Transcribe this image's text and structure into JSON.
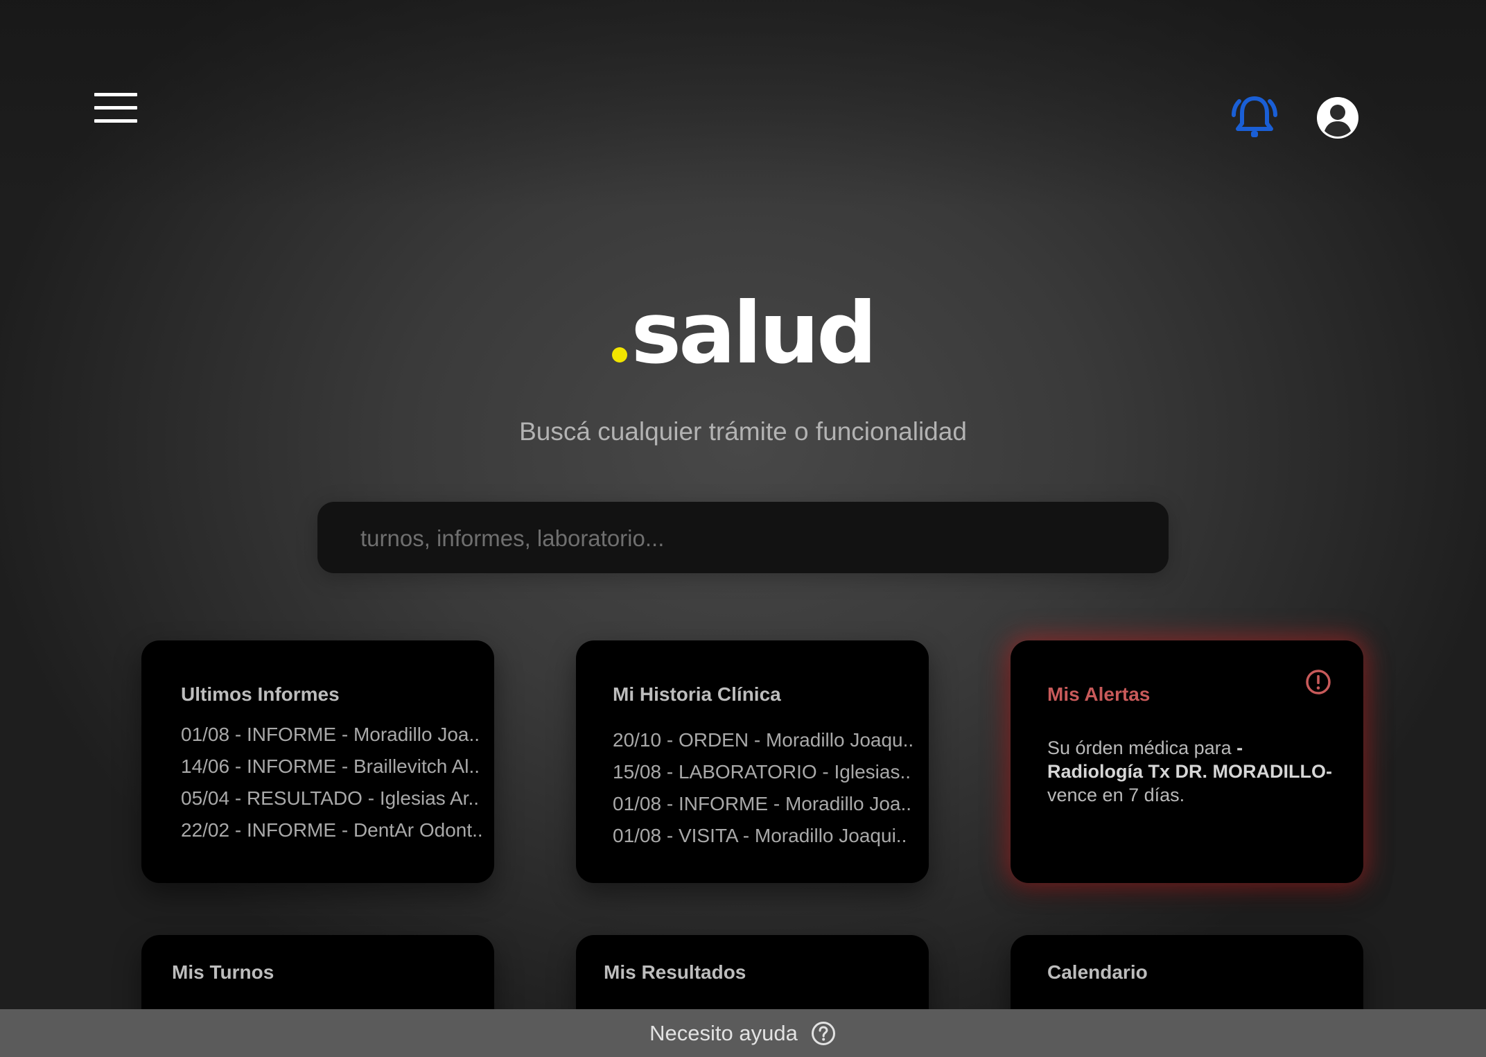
{
  "header": {
    "menu_icon": "hamburger-menu-icon",
    "notifications_icon": "bell-ringing-icon",
    "notifications_color": "#1a5fd6",
    "profile_icon": "user-circle-icon"
  },
  "brand": {
    "dot": ".",
    "name": "salud",
    "dot_color": "#f2e500"
  },
  "hero": {
    "subtitle": "Buscá cualquier trámite o funcionalidad"
  },
  "search": {
    "placeholder": "turnos, informes, laboratorio...",
    "value": ""
  },
  "cards": {
    "informes": {
      "title": "Ultimos Informes",
      "items": [
        "01/08 - INFORME - Moradillo Joa..",
        "14/06 - INFORME - Braillevitch Al..",
        "05/04 - RESULTADO - Iglesias Ar..",
        "22/02 - INFORME - DentAr Odont.."
      ]
    },
    "historia": {
      "title": "Mi Historia Clínica",
      "items": [
        "20/10 - ORDEN - Moradillo Joaqu..",
        "15/08 - LABORATORIO  - Iglesias..",
        "01/08 - INFORME - Moradillo Joa..",
        "01/08 -  VISITA - Moradillo Joaqui.."
      ]
    },
    "alertas": {
      "title": "Mis Alertas",
      "title_color": "#c85a5a",
      "glow_color": "#c42828",
      "icon": "alert-circle-icon",
      "message_prefix": "Su órden médica para ",
      "message_bold": "-Radiología Tx DR. MORADILLO-",
      "message_suffix": " vence en 7 días."
    },
    "turnos": {
      "title": "Mis Turnos"
    },
    "resultados": {
      "title": "Mis Resultados"
    },
    "calendario": {
      "title": "Calendario"
    }
  },
  "footer": {
    "help_label": "Necesito ayuda",
    "help_icon": "question-circle-icon"
  }
}
